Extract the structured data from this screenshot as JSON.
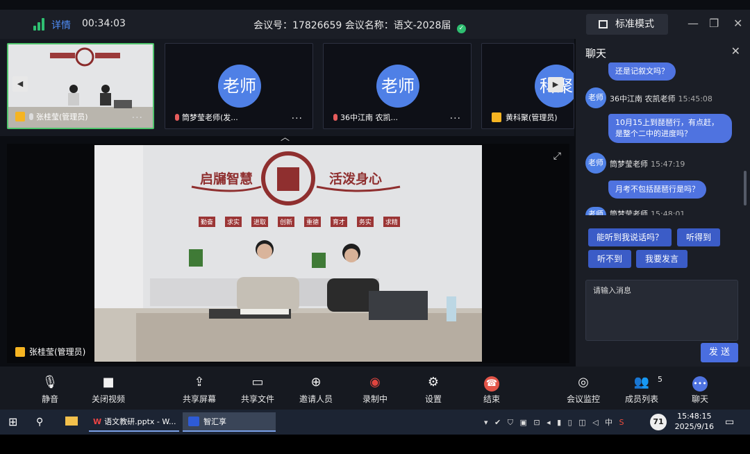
{
  "header": {
    "detail_label": "详情",
    "timer": "00:34:03",
    "meeting_info": "会议号：17826659 会议名称：语文-2028届",
    "mode_label": "标准模式",
    "win_min": "—",
    "win_max": "❐",
    "win_close": "✕"
  },
  "thumbs": [
    {
      "name": "张桂莹(管理员)",
      "avatar": "",
      "active": true
    },
    {
      "name": "筒梦莹老师(发...",
      "avatar": "老师"
    },
    {
      "name": "36中江南 农凯...",
      "avatar": "老师"
    },
    {
      "name": "黄科聚(管理员)",
      "avatar": "科聚"
    }
  ],
  "main_video": {
    "name": "张桂莹(管理员)",
    "banner_left": "启牖智慧",
    "banner_right": "活泼身心",
    "mottos": [
      "勤奋",
      "求实",
      "进取",
      "创新",
      "重德",
      "育才",
      "务实",
      "求精"
    ]
  },
  "chat": {
    "title": "聊天",
    "messages": [
      {
        "type": "out",
        "text": "还是记叙文吗？"
      },
      {
        "type": "sender",
        "avatar": "老师",
        "name": "36中江南 农凯老师",
        "time": "15:45:08"
      },
      {
        "type": "out",
        "text": "10月15上到琵琶行，有点赶，是整个二中的进度吗？"
      },
      {
        "type": "sender",
        "avatar": "老师",
        "name": "筒梦莹老师",
        "time": "15:47:19"
      },
      {
        "type": "out",
        "text": "月考不包括琵琶行是吗？"
      },
      {
        "type": "sender",
        "avatar": "老师",
        "name": "筒梦莹老师",
        "time": "15:48:01"
      }
    ],
    "quick_replies": [
      "能听到我说话吗？",
      "听得到",
      "听不到",
      "我要发言"
    ],
    "input_placeholder": "请输入消息",
    "send_label": "发 送"
  },
  "toolbar": [
    {
      "label": "静音",
      "icon": "mic-icon"
    },
    {
      "label": "关闭视频",
      "icon": "camera-icon"
    },
    {
      "label": "共享屏幕",
      "icon": "share-screen-icon"
    },
    {
      "label": "共享文件",
      "icon": "folder-icon"
    },
    {
      "label": "邀请人员",
      "icon": "add-user-icon"
    },
    {
      "label": "录制中",
      "icon": "record-icon"
    },
    {
      "label": "设置",
      "icon": "gear-icon"
    },
    {
      "label": "结束",
      "icon": "hangup-icon"
    },
    {
      "label": "会议监控",
      "icon": "webcam-icon"
    },
    {
      "label": "成员列表",
      "icon": "members-icon",
      "badge": "5"
    },
    {
      "label": "聊天",
      "icon": "chat-icon"
    }
  ],
  "taskbar": {
    "app1": "语文教研.pptx - W...",
    "app2": "智汇享",
    "tray_text": "中",
    "battery": "71",
    "time": "15:48:15",
    "date": "2025/9/16"
  },
  "colors": {
    "accent": "#4f73e0",
    "record": "#e0453f",
    "hangup": "#e25448",
    "active_border": "#4fc46c"
  }
}
